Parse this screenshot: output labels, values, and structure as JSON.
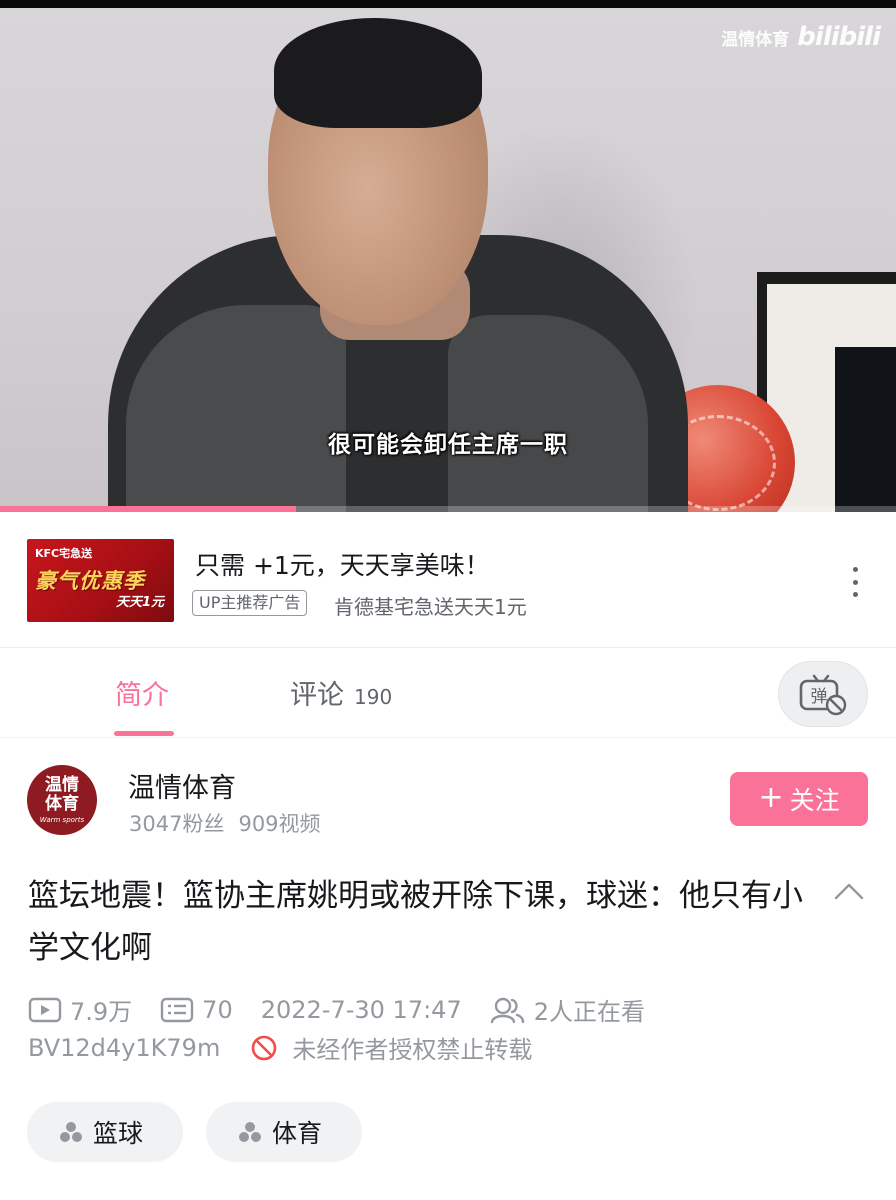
{
  "video": {
    "subtitle": "很可能会卸任主席一职",
    "watermark_channel": "温情体育",
    "watermark_logo": "bilibili",
    "progress_fraction": 0.33
  },
  "ad": {
    "thumb_brand": "KFC宅急送",
    "thumb_promo": "豪气优惠季",
    "thumb_daily": "天天1元",
    "title": "只需 +1元，天天享美味！",
    "tag": "UP主推荐广告",
    "subtitle": "肯德基宅急送天天1元",
    "more_icon": "more-vertical-icon"
  },
  "tabs": {
    "intro_label": "简介",
    "comment_label": "评论",
    "comment_count": "190",
    "danmaku_icon": "danmaku-toggle-icon",
    "danmaku_glyph": "弹"
  },
  "uploader": {
    "avatar_text": "温情体育",
    "avatar_sub": "Warm sports",
    "name": "温情体育",
    "fans": "3047粉丝",
    "videos": "909视频",
    "follow_label": "关注"
  },
  "video_info": {
    "title": "篮坛地震！篮协主席姚明或被开除下课，球迷：他只有小学文化啊",
    "views": "7.9万",
    "danmaku_count": "70",
    "date": "2022-7-30 17:47",
    "watching": "2人正在看",
    "bvid": "BV12d4y1K79m",
    "reprint_notice": "未经作者授权禁止转载"
  },
  "tags": [
    {
      "label": "篮球",
      "icon": "tag-icon"
    },
    {
      "label": "体育",
      "icon": "tag-icon"
    }
  ],
  "colors": {
    "accent": "#fb7299",
    "text_primary": "#18191c",
    "text_secondary": "#61666d",
    "text_muted": "#9499a0",
    "danger": "#f04c49"
  }
}
